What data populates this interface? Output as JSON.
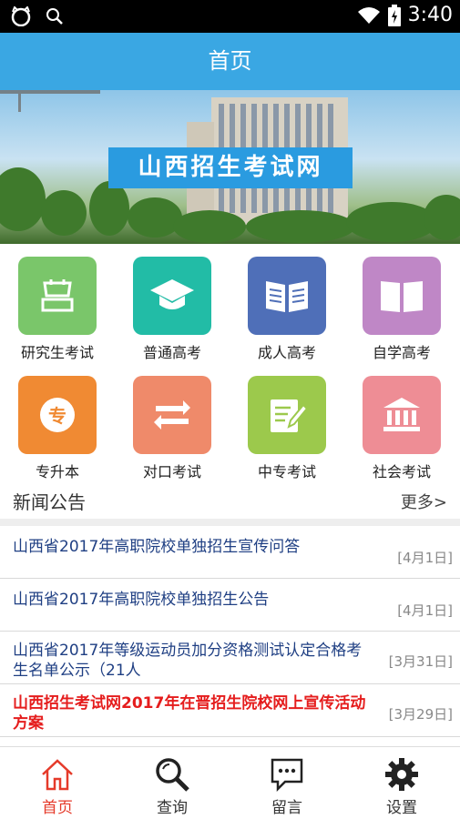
{
  "status": {
    "time": "3:40"
  },
  "titlebar": {
    "title": "首页"
  },
  "banner": {
    "title": "山西招生考试网"
  },
  "categories": [
    {
      "label": "研究生考试",
      "color": "#7ac66a",
      "icon": "graduate-hat-outline-icon"
    },
    {
      "label": "普通高考",
      "color": "#22bca6",
      "icon": "graduation-cap-icon"
    },
    {
      "label": "成人高考",
      "color": "#4f6fb8",
      "icon": "open-book-reading-icon"
    },
    {
      "label": "自学高考",
      "color": "#bf87c6",
      "icon": "open-book-icon"
    },
    {
      "label": "专升本",
      "color": "#f08a33",
      "icon": "zhuan-badge-icon"
    },
    {
      "label": "对口考试",
      "color": "#ef8a6a",
      "icon": "swap-arrows-icon"
    },
    {
      "label": "中专考试",
      "color": "#9cc94c",
      "icon": "edit-note-icon"
    },
    {
      "label": "社会考试",
      "color": "#ee8d95",
      "icon": "institution-icon"
    }
  ],
  "news": {
    "heading": "新闻公告",
    "more": "更多>",
    "items": [
      {
        "title": "山西省2017年高职院校单独招生宣传问答",
        "date": "[4月1日]"
      },
      {
        "title": "山西省2017年高职院校单独招生公告",
        "date": "[4月1日]"
      },
      {
        "title": "山西省2017年等级运动员加分资格测试认定合格考生名单公示（21人",
        "date": "[3月31日]"
      },
      {
        "title": "山西招生考试网2017年在晋招生院校网上宣传活动方案",
        "date": "[3月29日]",
        "highlight": true
      }
    ]
  },
  "nav": [
    {
      "label": "首页",
      "icon": "home-icon",
      "active": true
    },
    {
      "label": "查询",
      "icon": "search-icon"
    },
    {
      "label": "留言",
      "icon": "message-icon"
    },
    {
      "label": "设置",
      "icon": "settings-gear-icon"
    }
  ],
  "colors": {
    "accent": "#3aa7e3",
    "active_nav": "#e53a2a",
    "news_title": "#1f3f83",
    "news_highlight": "#e51d1d"
  }
}
